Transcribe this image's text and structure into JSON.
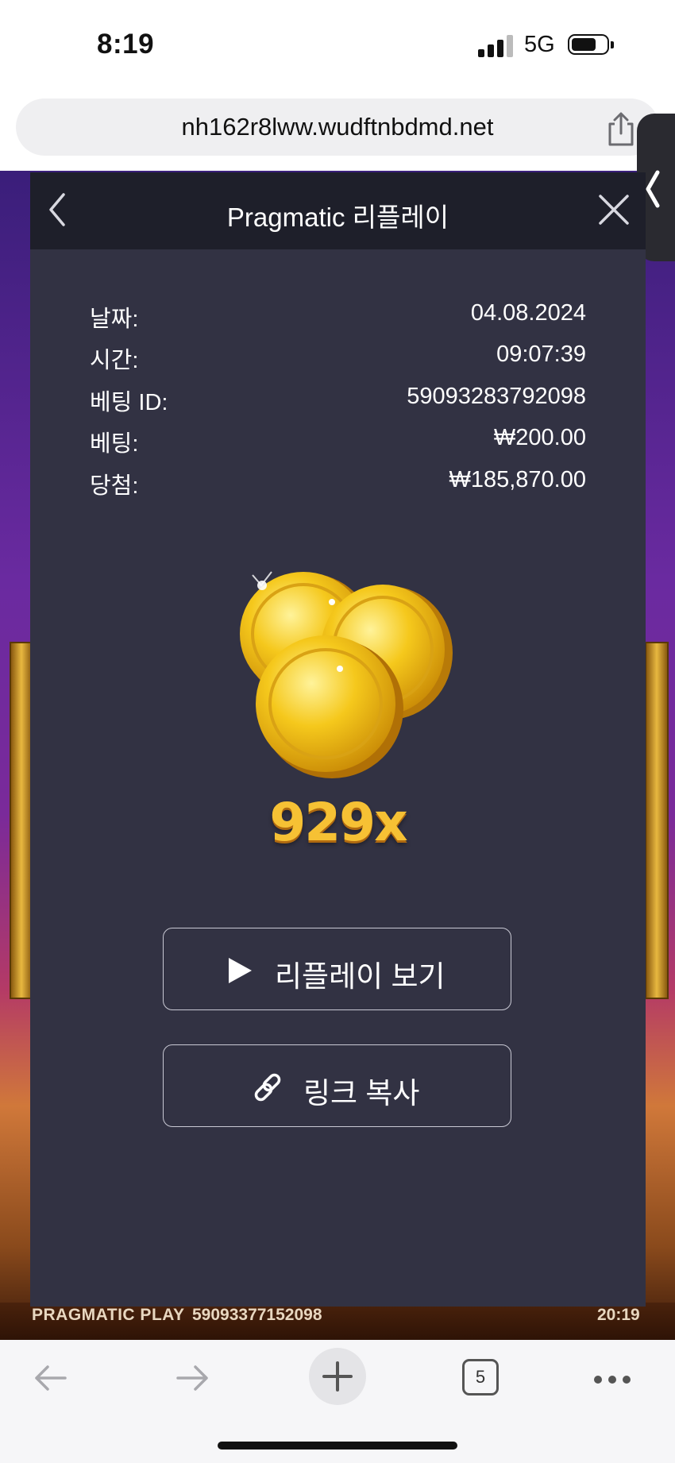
{
  "status_bar": {
    "time": "8:19",
    "network": "5G"
  },
  "browser": {
    "url": "nh162r8lww.wudftnbdmd.net",
    "tab_count": "5"
  },
  "game_footer": {
    "brand": "PRAGMATIC PLAY",
    "round_id": "59093377152098",
    "time": "20:19"
  },
  "modal": {
    "title": "Pragmatic 리플레이",
    "info": [
      {
        "label": "날짜:",
        "value": "04.08.2024"
      },
      {
        "label": "시간:",
        "value": "09:07:39"
      },
      {
        "label": "베팅 ID:",
        "value": "59093283792098"
      },
      {
        "label": "베팅:",
        "value": "₩200.00"
      },
      {
        "label": "당첨:",
        "value": "₩185,870.00"
      }
    ],
    "multiplier": "929x",
    "watch_replay_label": "리플레이 보기",
    "copy_link_label": "링크 복사"
  },
  "icons": [
    "back-icon",
    "close-icon",
    "play-icon",
    "link-icon",
    "share-icon",
    "arrow-left-icon",
    "arrow-right-icon",
    "plus-icon",
    "tabs-icon",
    "more-icon",
    "signal-icon",
    "battery-icon",
    "coins-icon"
  ],
  "colors": {
    "modal_bg": "#323243",
    "modal_header": "#1e1f2a",
    "multiplier": "#f6c134"
  }
}
